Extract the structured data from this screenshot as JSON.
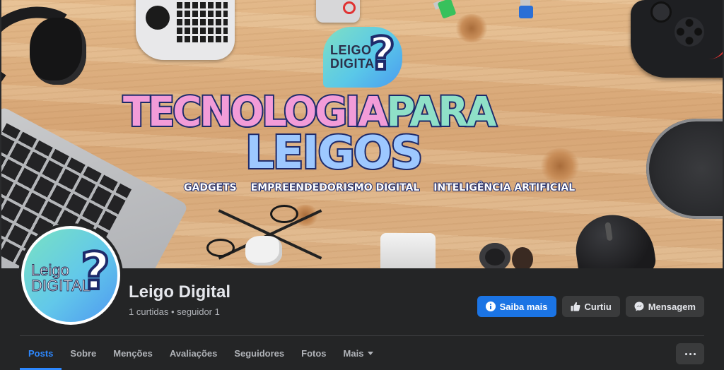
{
  "cover": {
    "logo_text_line1": "LEIGO",
    "logo_text_line2": "DIGITAL",
    "logo_symbol": "?",
    "headline_part1": "TECNOLOGIA",
    "headline_part2": "PARA",
    "headline_line2": "LEIGOS",
    "tags": [
      "GADGETS",
      "EMPREENDEDORISMO DIGITAL",
      "INTELIGÊNCIA ARTIFICIAL"
    ]
  },
  "profile": {
    "avatar_line1": "Leigo",
    "avatar_line2": "DIGITAL",
    "avatar_symbol": "?",
    "name": "Leigo Digital",
    "stats": "1 curtidas • seguidor 1"
  },
  "actions": {
    "learn_more": "Saiba mais",
    "liked": "Curtiu",
    "message": "Mensagem"
  },
  "tabs": [
    {
      "label": "Posts",
      "active": true
    },
    {
      "label": "Sobre"
    },
    {
      "label": "Menções"
    },
    {
      "label": "Avaliações"
    },
    {
      "label": "Seguidores"
    },
    {
      "label": "Fotos"
    },
    {
      "label": "Mais"
    }
  ],
  "icons": {
    "learn_more": "info-icon",
    "liked": "thumbs-up-icon",
    "message": "messenger-icon",
    "more": "ellipsis-icon",
    "tab_more": "caret-down-icon"
  },
  "colors": {
    "primary": "#1b74e4",
    "active_tab": "#2d88ff",
    "background": "#242526"
  }
}
